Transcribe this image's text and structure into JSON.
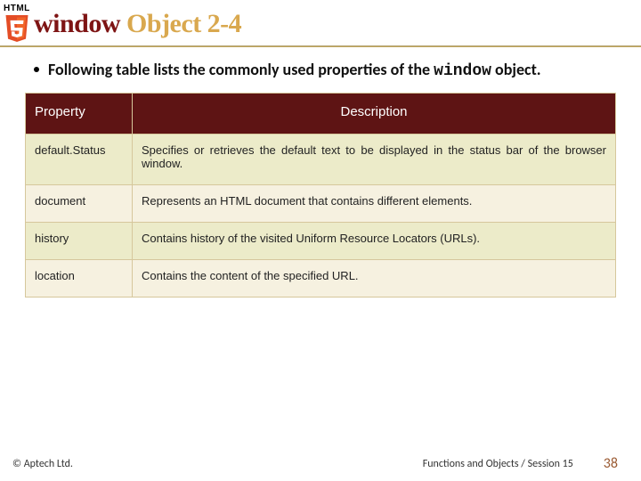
{
  "logo": {
    "word": "HTML"
  },
  "title": {
    "a": "window ",
    "b": "Object 2-4"
  },
  "bullet": {
    "pre": "Following table lists the commonly used properties of the ",
    "code": "window",
    "post": " object."
  },
  "table": {
    "headers": {
      "property": "Property",
      "description": "Description"
    },
    "rows": [
      {
        "prop": "default.Status",
        "desc": "Specifies or retrieves the default text to be displayed in the status bar of the browser window."
      },
      {
        "prop": "document",
        "desc": "Represents an HTML document that contains different elements."
      },
      {
        "prop": "history",
        "desc": "Contains history of the visited Uniform Resource Locators (URLs)."
      },
      {
        "prop": "location",
        "desc": "Contains the content of the specified URL."
      }
    ]
  },
  "footer": {
    "copyright": "© Aptech Ltd.",
    "session": "Functions and Objects / Session 15",
    "page": "38"
  }
}
